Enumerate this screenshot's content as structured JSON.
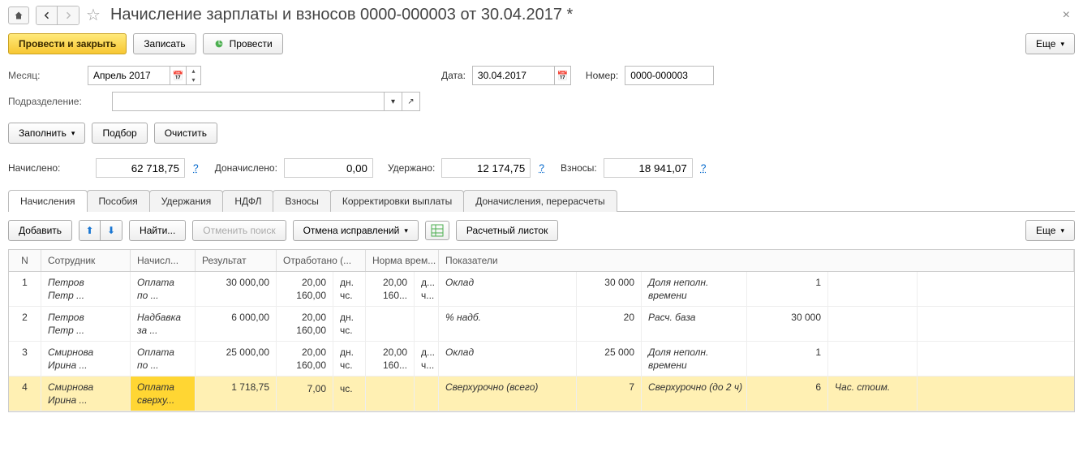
{
  "header": {
    "title": "Начисление зарплаты и взносов 0000-000003 от 30.04.2017 *"
  },
  "toolbar": {
    "post_close": "Провести и закрыть",
    "save": "Записать",
    "post": "Провести",
    "more": "Еще"
  },
  "fields": {
    "month_label": "Месяц:",
    "month_value": "Апрель 2017",
    "date_label": "Дата:",
    "date_value": "30.04.2017",
    "number_label": "Номер:",
    "number_value": "0000-000003",
    "dept_label": "Подразделение:",
    "dept_value": ""
  },
  "actions": {
    "fill": "Заполнить",
    "pick": "Подбор",
    "clear": "Очистить"
  },
  "totals": {
    "accrued_label": "Начислено:",
    "accrued_value": "62 718,75",
    "additional_label": "Доначислено:",
    "additional_value": "0,00",
    "withheld_label": "Удержано:",
    "withheld_value": "12 174,75",
    "contrib_label": "Взносы:",
    "contrib_value": "18 941,07"
  },
  "tabs": [
    {
      "label": "Начисления",
      "active": true
    },
    {
      "label": "Пособия"
    },
    {
      "label": "Удержания"
    },
    {
      "label": "НДФЛ"
    },
    {
      "label": "Взносы"
    },
    {
      "label": "Корректировки выплаты"
    },
    {
      "label": "Доначисления, перерасчеты"
    }
  ],
  "tab_toolbar": {
    "add": "Добавить",
    "find": "Найти...",
    "cancel_find": "Отменить поиск",
    "cancel_fix": "Отмена исправлений",
    "payslip": "Расчетный листок",
    "more": "Еще"
  },
  "columns": {
    "n": "N",
    "employee": "Сотрудник",
    "accrual": "Начисл...",
    "result": "Результат",
    "worked": "Отработано (...",
    "norm": "Норма врем...",
    "indicators": "Показатели"
  },
  "rows": [
    {
      "n": "1",
      "emp1": "Петров",
      "emp2": "Петр ...",
      "acc1": "Оплата",
      "acc2": "по ...",
      "res": "30 000,00",
      "w1": "20,00",
      "w1u": "дн.",
      "w2": "160,00",
      "w2u": "чс.",
      "n1": "20,00",
      "n1u": "д...",
      "n2": "160...",
      "n2u": "ч...",
      "i1": "Оклад",
      "i1v": "30 000",
      "i2": "Доля неполн.",
      "i2b": "времени",
      "i2v": "1",
      "i3": ""
    },
    {
      "n": "2",
      "emp1": "Петров",
      "emp2": "Петр ...",
      "acc1": "Надбавка",
      "acc2": "за ...",
      "res": "6 000,00",
      "w1": "20,00",
      "w1u": "дн.",
      "w2": "160,00",
      "w2u": "чс.",
      "n1": "",
      "n1u": "",
      "n2": "",
      "n2u": "",
      "i1": "% надб.",
      "i1v": "20",
      "i2": "Расч. база",
      "i2b": "",
      "i2v": "30 000",
      "i3": ""
    },
    {
      "n": "3",
      "emp1": "Смирнова",
      "emp2": "Ирина ...",
      "acc1": "Оплата",
      "acc2": "по ...",
      "res": "25 000,00",
      "w1": "20,00",
      "w1u": "дн.",
      "w2": "160,00",
      "w2u": "чс.",
      "n1": "20,00",
      "n1u": "д...",
      "n2": "160...",
      "n2u": "ч...",
      "i1": "Оклад",
      "i1v": "25 000",
      "i2": "Доля неполн.",
      "i2b": "времени",
      "i2v": "1",
      "i3": ""
    },
    {
      "n": "4",
      "emp1": "Смирнова",
      "emp2": "Ирина ...",
      "acc1": "Оплата",
      "acc2": "сверху...",
      "res": "1 718,75",
      "w1": "",
      "w1u": "",
      "w2": "7,00",
      "w2u": "чс.",
      "n1": "",
      "n1u": "",
      "n2": "",
      "n2u": "",
      "i1": "Сверхурочно (всего)",
      "i1v": "7",
      "i2": "Сверхурочно (до 2 ч)",
      "i2b": "",
      "i2v": "6",
      "i3": "Час. стоим.",
      "selected": true
    }
  ]
}
